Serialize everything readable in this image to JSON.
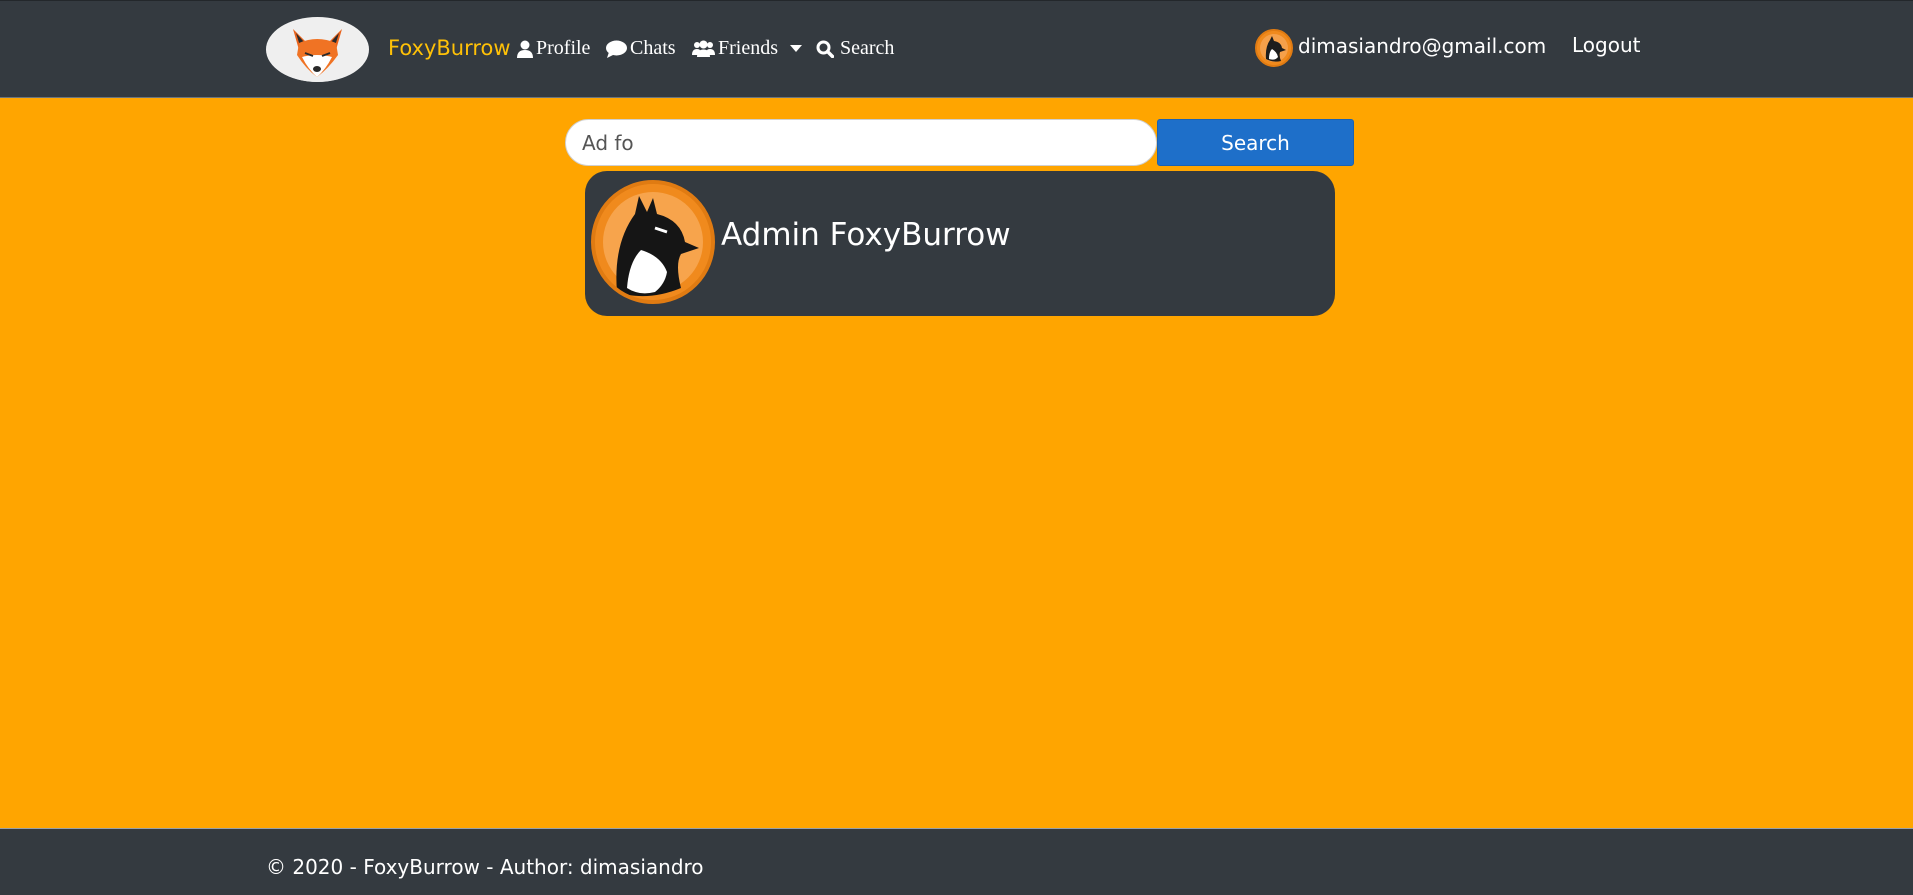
{
  "navbar": {
    "brand": "FoxyBurrow",
    "items": [
      {
        "label": "Profile",
        "icon": "user-icon"
      },
      {
        "label": "Chats",
        "icon": "chat-bubble-icon"
      },
      {
        "label": "Friends",
        "icon": "users-icon"
      },
      {
        "label": "Search",
        "icon": "search-icon"
      }
    ],
    "user_email": "dimasiandro@gmail.com",
    "logout_label": "Logout"
  },
  "search": {
    "value": "Ad fo",
    "button_label": "Search"
  },
  "results": [
    {
      "name": "Admin FoxyBurrow"
    }
  ],
  "footer": {
    "text": "© 2020 - FoxyBurrow - Author: dimasiandro"
  },
  "colors": {
    "page_background": "#ffa500",
    "navbar": "#343a40",
    "brand": "#ffc107",
    "search_button": "#1e6fc9"
  }
}
